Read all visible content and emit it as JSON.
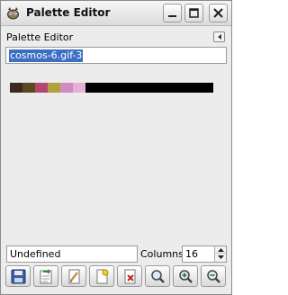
{
  "window": {
    "title": "Palette Editor"
  },
  "dock": {
    "title": "Palette Editor"
  },
  "palette": {
    "name": "cosmos-6.gif-3",
    "swatches": [
      "#3a2a20",
      "#5a4a20",
      "#b04870",
      "#b4a040",
      "#d08cc0",
      "#e8b0d8"
    ],
    "empty_color": "#000000"
  },
  "color_entry": {
    "value": "Undefined"
  },
  "columns": {
    "label": "Columns:",
    "value": "16"
  },
  "toolbar": {
    "buttons": [
      {
        "icon": "save-icon"
      },
      {
        "icon": "revert-icon"
      },
      {
        "icon": "edit-color-icon"
      },
      {
        "icon": "new-color-icon"
      },
      {
        "icon": "delete-color-icon"
      },
      {
        "icon": "zoom-all-icon"
      },
      {
        "icon": "zoom-in-icon"
      },
      {
        "icon": "zoom-out-icon"
      }
    ]
  }
}
